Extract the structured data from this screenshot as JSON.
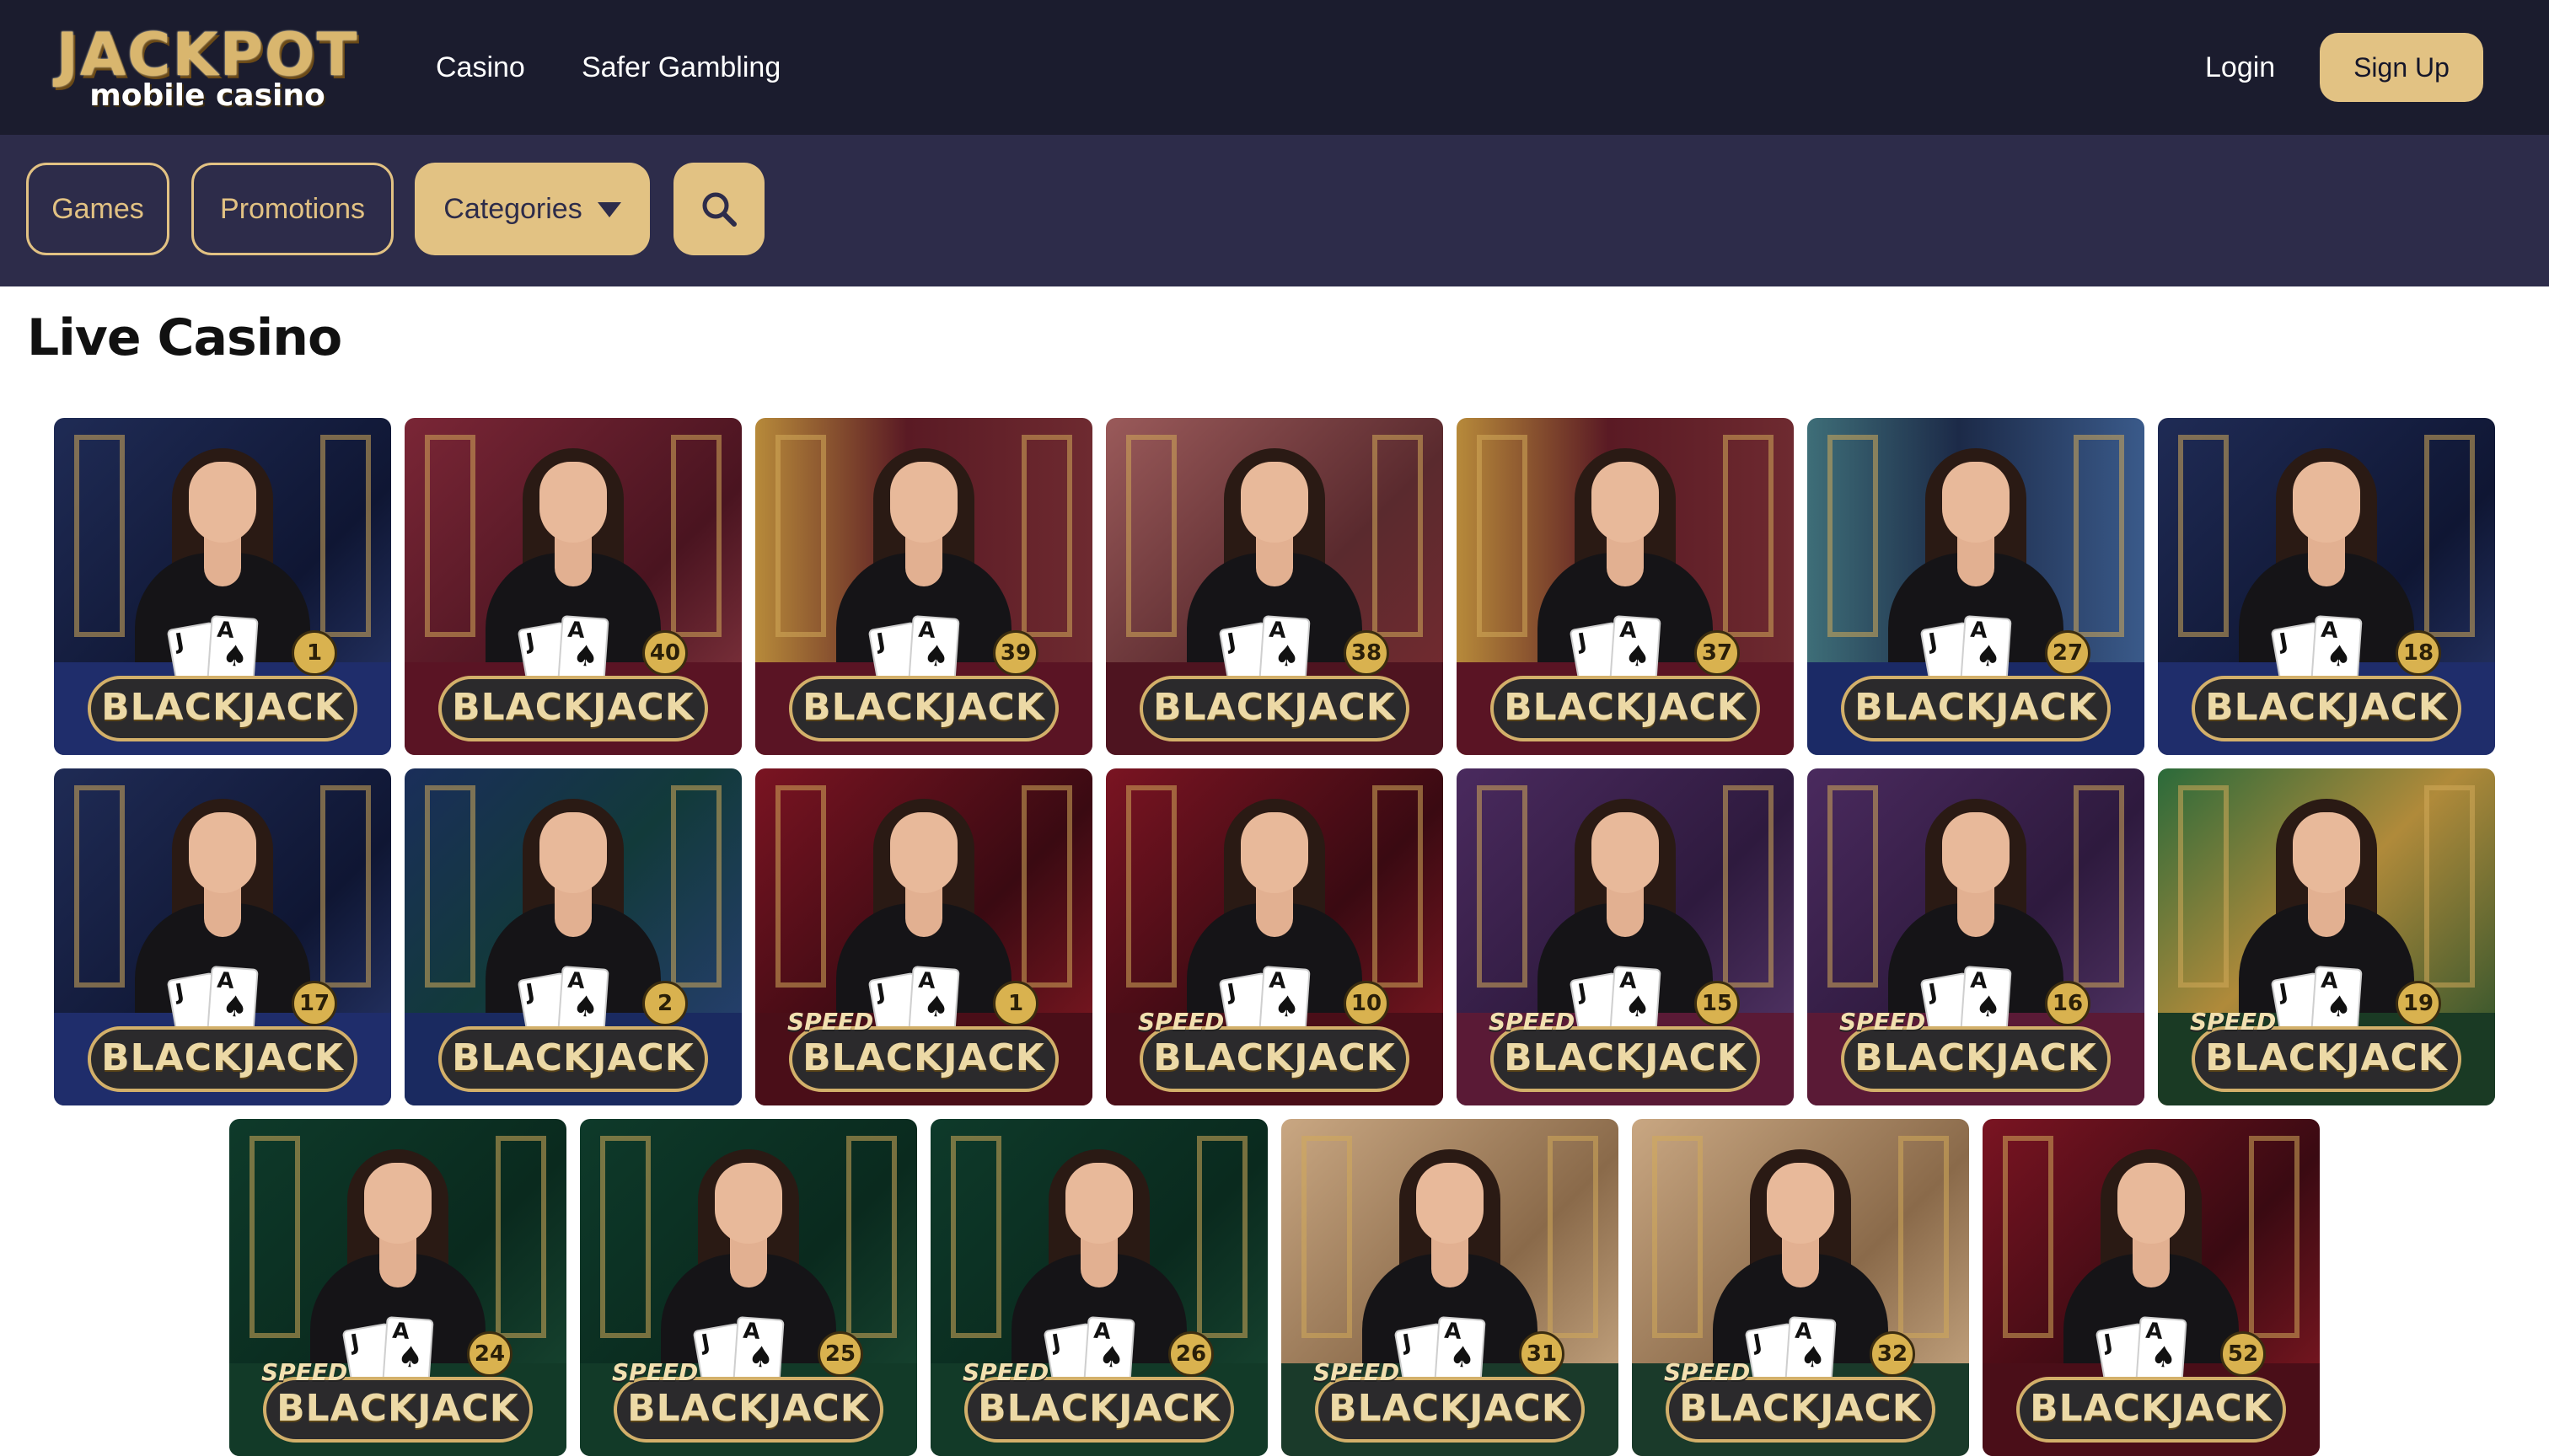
{
  "header": {
    "logo": {
      "word": "JACKPOT",
      "sub": "mobile casino"
    },
    "nav": [
      {
        "id": "casino",
        "label": "Casino"
      },
      {
        "id": "safer",
        "label": "Safer Gambling"
      }
    ],
    "login_label": "Login",
    "signup_label": "Sign Up"
  },
  "subnav": {
    "games_label": "Games",
    "promotions_label": "Promotions",
    "categories_label": "Categories",
    "search_icon": "search-icon"
  },
  "section": {
    "title": "Live Casino"
  },
  "colors": {
    "header_bg": "#1b1c2e",
    "subnav_bg": "#2d2c4a",
    "accent_gold": "#e2c283"
  },
  "tiles": [
    {
      "title": "BLACKJACK",
      "number": "1",
      "speed": false,
      "theme": "navy"
    },
    {
      "title": "BLACKJACK",
      "number": "40",
      "speed": false,
      "theme": "wine"
    },
    {
      "title": "BLACKJACK",
      "number": "39",
      "speed": false,
      "theme": "gold"
    },
    {
      "title": "BLACKJACK",
      "number": "38",
      "speed": false,
      "theme": "rose"
    },
    {
      "title": "BLACKJACK",
      "number": "37",
      "speed": false,
      "theme": "gold"
    },
    {
      "title": "BLACKJACK",
      "number": "27",
      "speed": false,
      "theme": "teal"
    },
    {
      "title": "BLACKJACK",
      "number": "18",
      "speed": false,
      "theme": "navy"
    },
    {
      "title": "BLACKJACK",
      "number": "17",
      "speed": false,
      "theme": "navy"
    },
    {
      "title": "BLACKJACK",
      "number": "2",
      "speed": false,
      "theme": "blue"
    },
    {
      "title": "BLACKJACK",
      "number": "1",
      "speed": true,
      "label": "SPEED",
      "theme": "red"
    },
    {
      "title": "BLACKJACK",
      "number": "10",
      "speed": true,
      "label": "SPEED",
      "theme": "red"
    },
    {
      "title": "BLACKJACK",
      "number": "15",
      "speed": true,
      "label": "SPEED",
      "theme": "purple"
    },
    {
      "title": "BLACKJACK",
      "number": "16",
      "speed": true,
      "label": "SPEED",
      "theme": "purple"
    },
    {
      "title": "BLACKJACK",
      "number": "19",
      "speed": true,
      "label": "SPEED",
      "theme": "emerald"
    },
    {
      "title": "BLACKJACK",
      "number": "24",
      "speed": true,
      "label": "SPEED",
      "theme": "green"
    },
    {
      "title": "BLACKJACK",
      "number": "25",
      "speed": true,
      "label": "SPEED",
      "theme": "green"
    },
    {
      "title": "BLACKJACK",
      "number": "26",
      "speed": true,
      "label": "SPEED",
      "theme": "green"
    },
    {
      "title": "BLACKJACK",
      "number": "31",
      "speed": true,
      "label": "SPEED",
      "theme": "beige"
    },
    {
      "title": "BLACKJACK",
      "number": "32",
      "speed": true,
      "label": "SPEED",
      "theme": "beige"
    },
    {
      "title": "BLACKJACK",
      "number": "52",
      "speed": false,
      "theme": "red"
    }
  ]
}
